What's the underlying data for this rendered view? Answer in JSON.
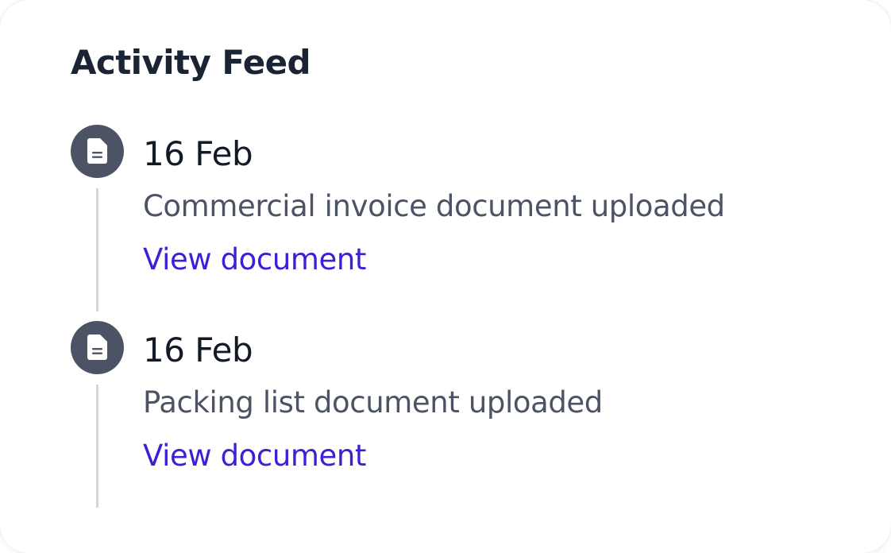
{
  "feed": {
    "title": "Activity Feed",
    "items": [
      {
        "date": "16 Feb",
        "description": "Commercial invoice document uploaded",
        "link_label": "View document",
        "icon": "document-icon"
      },
      {
        "date": "16 Feb",
        "description": "Packing list document uploaded",
        "link_label": "View document",
        "icon": "document-icon"
      }
    ]
  },
  "colors": {
    "title": "#1b2434",
    "icon_background": "#4b5364",
    "description": "#4b5364",
    "link": "#3a20d6",
    "timeline_line": "#d4d6da"
  }
}
